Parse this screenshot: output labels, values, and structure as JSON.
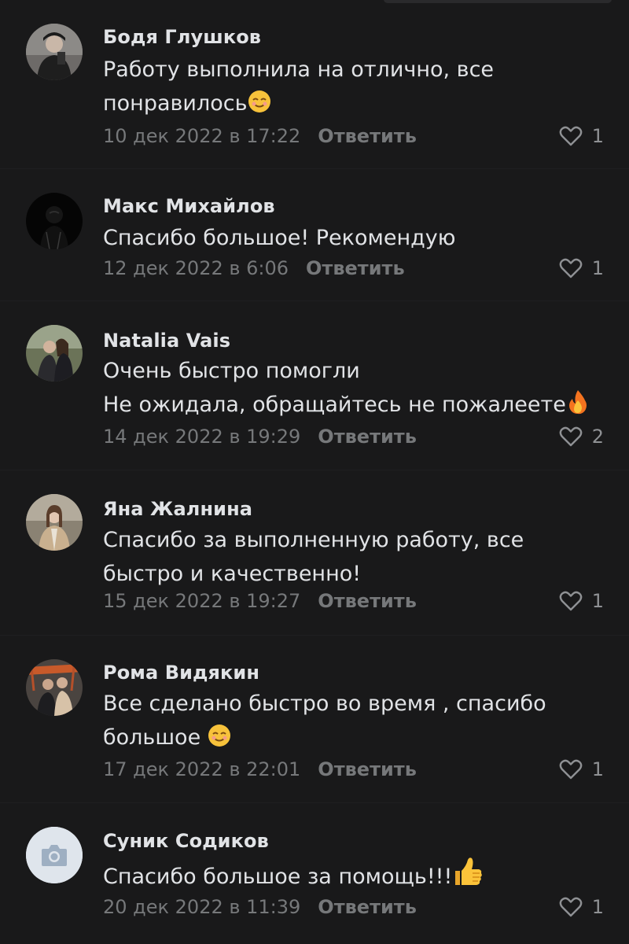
{
  "comments": [
    {
      "author": "Бодя Глушков",
      "lines": [
        "Работу выполнила на отлично, все",
        "понравилось"
      ],
      "emoji": "smiling-face-emoji",
      "date": "10 дек 2022 в 17:22",
      "reply": "Ответить",
      "likes": "1"
    },
    {
      "author": "Макс Михайлов",
      "lines": [
        "Спасибо большое! Рекомендую"
      ],
      "date": "12 дек 2022 в 6:06",
      "reply": "Ответить",
      "likes": "1"
    },
    {
      "author": "Natalia Vais",
      "lines": [
        "Очень быстро помогли",
        "Не ожидала, обращайтесь не пожалеете"
      ],
      "emoji": "fire-emoji",
      "date": "14 дек 2022 в 19:29",
      "reply": "Ответить",
      "likes": "2"
    },
    {
      "author": "Яна Жалнина",
      "lines": [
        "Спасибо за выполненную работу, все",
        "быстро и качественно!"
      ],
      "date": "15 дек 2022 в 19:27",
      "reply": "Ответить",
      "likes": "1"
    },
    {
      "author": "Рома Видякин",
      "lines": [
        "Все сделано быстро во время , спасибо",
        "большое"
      ],
      "emoji": "smiling-face-emoji",
      "date": "17 дек 2022 в 22:01",
      "reply": "Ответить",
      "likes": "1"
    },
    {
      "author": "Суник Содиков",
      "lines": [
        "Спасибо большое за помощь!!!"
      ],
      "emoji": "thumbs-up-emoji",
      "date": "20 дек 2022 в 11:39",
      "reply": "Ответить",
      "likes": "1"
    }
  ],
  "icons": {
    "like": "heart-outline-icon",
    "placeholder_avatar": "camera-icon"
  },
  "colors": {
    "background": "#19191a",
    "text": "#e1e3e6",
    "secondary": "#76787a"
  }
}
